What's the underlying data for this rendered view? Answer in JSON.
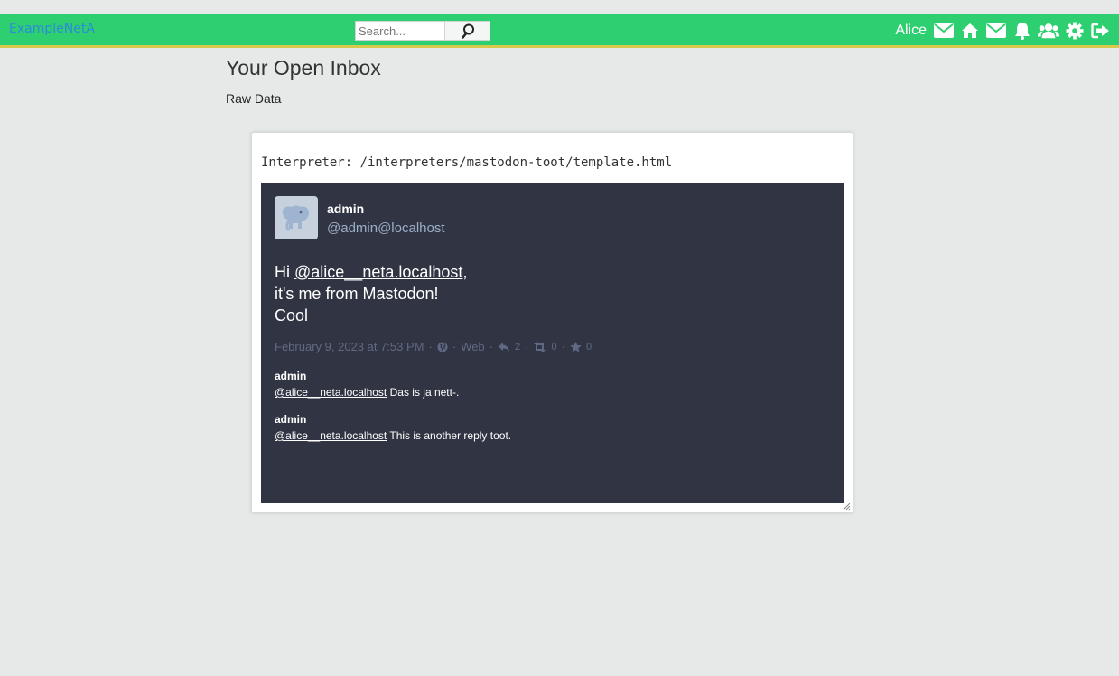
{
  "header": {
    "brand": "ExampleNetA",
    "search_placeholder": "Search...",
    "user_name": "Alice",
    "nav_icons": [
      "envelope-icon",
      "home-icon",
      "envelope-icon",
      "bell-icon",
      "users-icon",
      "gear-icon",
      "sign-out-icon"
    ]
  },
  "page": {
    "title": "Your Open Inbox",
    "raw_link": "Raw Data",
    "interpreter": "Interpreter: /interpreters/mastodon-toot/template.html"
  },
  "toot": {
    "display_name": "admin",
    "acct": "@admin@localhost",
    "content": {
      "greeting": "Hi ",
      "mention": "@alice__neta.localhost",
      "comma": ",",
      "line2": "it's me from Mastodon!",
      "line3": "Cool"
    },
    "meta": {
      "timestamp": "February 9, 2023 at 7:53 PM",
      "sep": "·",
      "visibility_icon": "globe-icon",
      "app": "Web",
      "replies_count": "2",
      "boosts_count": "0",
      "favourites_count": "0"
    },
    "replies": [
      {
        "author": "admin",
        "mention": "@alice__neta.localhost",
        "text": " Das is ja nett-."
      },
      {
        "author": "admin",
        "mention": "@alice__neta.localhost",
        "text": " This is another reply toot."
      }
    ]
  },
  "colors": {
    "topbar": "#2ecf70",
    "topbar_border": "#d8c94a",
    "brand": "#2b8bdc",
    "toot_bg": "#313543",
    "meta": "#606984",
    "acct": "#9baec8"
  }
}
